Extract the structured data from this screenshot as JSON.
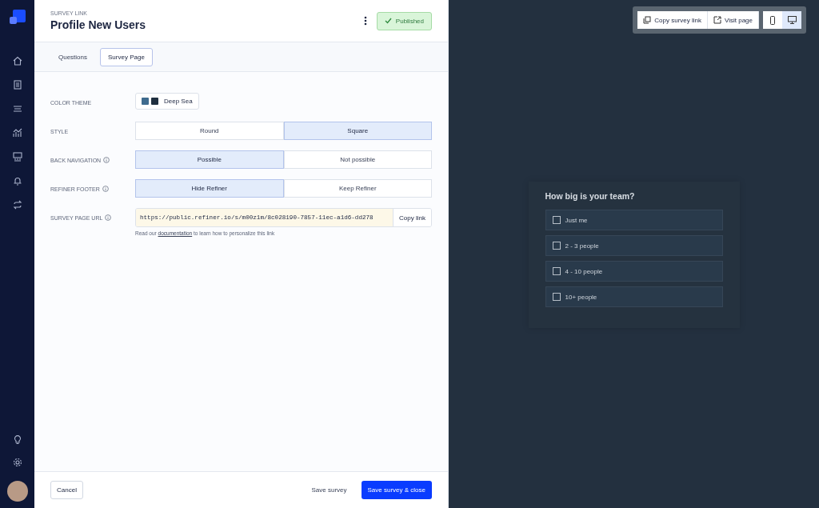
{
  "header": {
    "eyebrow": "SURVEY LINK",
    "title": "Profile New Users",
    "status": "Published"
  },
  "tabs": [
    {
      "label": "Questions",
      "selected": false
    },
    {
      "label": "Survey Page",
      "selected": true
    }
  ],
  "settings": [
    {
      "kind": "theme",
      "label": "COLOR THEME",
      "info": false,
      "value": "Deep Sea",
      "swatches": [
        {
          "color": "#3f6b8e"
        },
        {
          "color": "#1f2f3f"
        }
      ]
    },
    {
      "kind": "toggle",
      "label": "STYLE",
      "info": false,
      "options": [
        {
          "label": "Round",
          "selected": false
        },
        {
          "label": "Square",
          "selected": true
        }
      ]
    },
    {
      "kind": "toggle",
      "label": "BACK NAVIGATION",
      "info": true,
      "options": [
        {
          "label": "Possible",
          "selected": true
        },
        {
          "label": "Not possible",
          "selected": false
        }
      ]
    },
    {
      "kind": "toggle",
      "label": "REFINER FOOTER",
      "info": true,
      "options": [
        {
          "label": "Hide Refiner",
          "selected": true
        },
        {
          "label": "Keep Refiner",
          "selected": false
        }
      ]
    },
    {
      "kind": "url",
      "label": "SURVEY PAGE URL",
      "info": true,
      "value": "https://public.refiner.io/s/m00z1m/8c028190-7857-11ec-a1d6-dd278",
      "button": "Copy link",
      "help_before": "Read our ",
      "help_link": "documentation",
      "help_after": " to learn how to personalize this link"
    }
  ],
  "footer": {
    "cancel": "Cancel",
    "save": "Save survey",
    "save_close": "Save survey & close"
  },
  "preview_toolbar": {
    "copy": "Copy survey link",
    "visit": "Visit page",
    "devices": [
      {
        "kind": "mobile",
        "selected": false
      },
      {
        "kind": "desktop",
        "selected": true
      }
    ]
  },
  "preview": {
    "question": "How big is your team?",
    "options": [
      {
        "label": "Just me",
        "checked": false
      },
      {
        "label": "2 - 3 people",
        "checked": false
      },
      {
        "label": "4 - 10 people",
        "checked": false
      },
      {
        "label": "10+ people",
        "checked": false
      }
    ]
  }
}
